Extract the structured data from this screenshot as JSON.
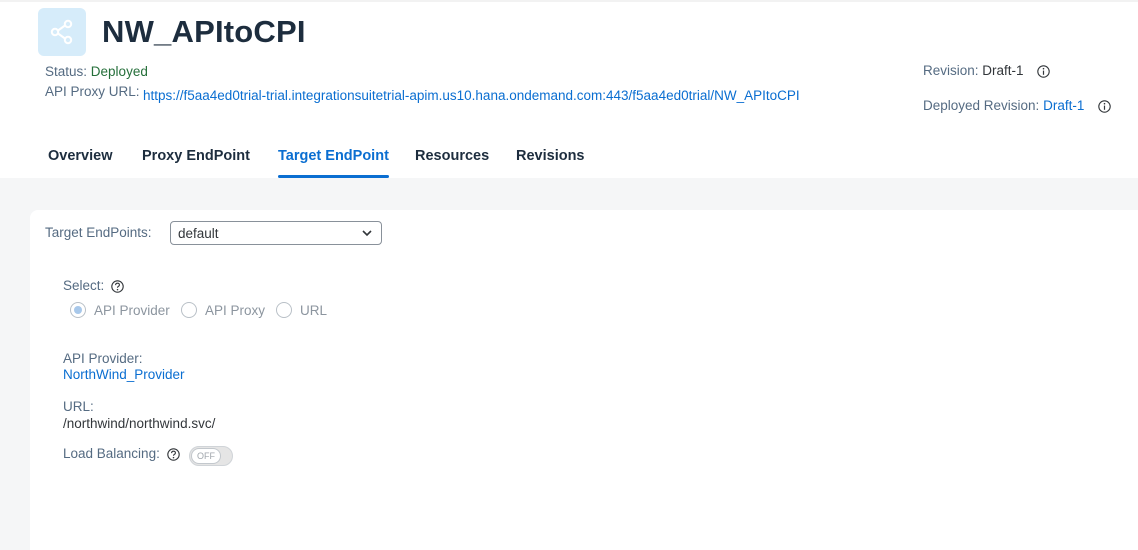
{
  "header": {
    "title": "NW_APItoCPI",
    "status_label": "Status:",
    "status_value": "Deployed",
    "proxy_url_label": "API Proxy URL:",
    "proxy_url": "https://f5aa4ed0trial-trial.integrationsuitetrial-apim.us10.hana.ondemand.com:443/f5aa4ed0trial/NW_APItoCPI",
    "revision_label": "Revision:",
    "revision_value": "Draft-1",
    "deployed_revision_label": "Deployed Revision:",
    "deployed_revision_value": "Draft-1",
    "icon": "share-icon"
  },
  "tabs": [
    {
      "label": "Overview",
      "active": false
    },
    {
      "label": "Proxy EndPoint",
      "active": false
    },
    {
      "label": "Target EndPoint",
      "active": true
    },
    {
      "label": "Resources",
      "active": false
    },
    {
      "label": "Revisions",
      "active": false
    }
  ],
  "target": {
    "endpoints_label": "Target EndPoints:",
    "endpoints_selected": "default",
    "select_label": "Select:",
    "radio_options": [
      {
        "label": "API Provider",
        "selected": true
      },
      {
        "label": "API Proxy",
        "selected": false
      },
      {
        "label": "URL",
        "selected": false
      }
    ],
    "provider_label": "API Provider:",
    "provider_value": "NorthWind_Provider",
    "url_label": "URL:",
    "url_value": "/northwind/northwind.svc/",
    "load_balancing_label": "Load Balancing:",
    "load_balancing_state": "OFF"
  },
  "colors": {
    "accent": "#0a6ed1",
    "status_green": "#256f3a",
    "header_line": "#0a4fa0",
    "icon_bg": "#d6ecfa"
  }
}
